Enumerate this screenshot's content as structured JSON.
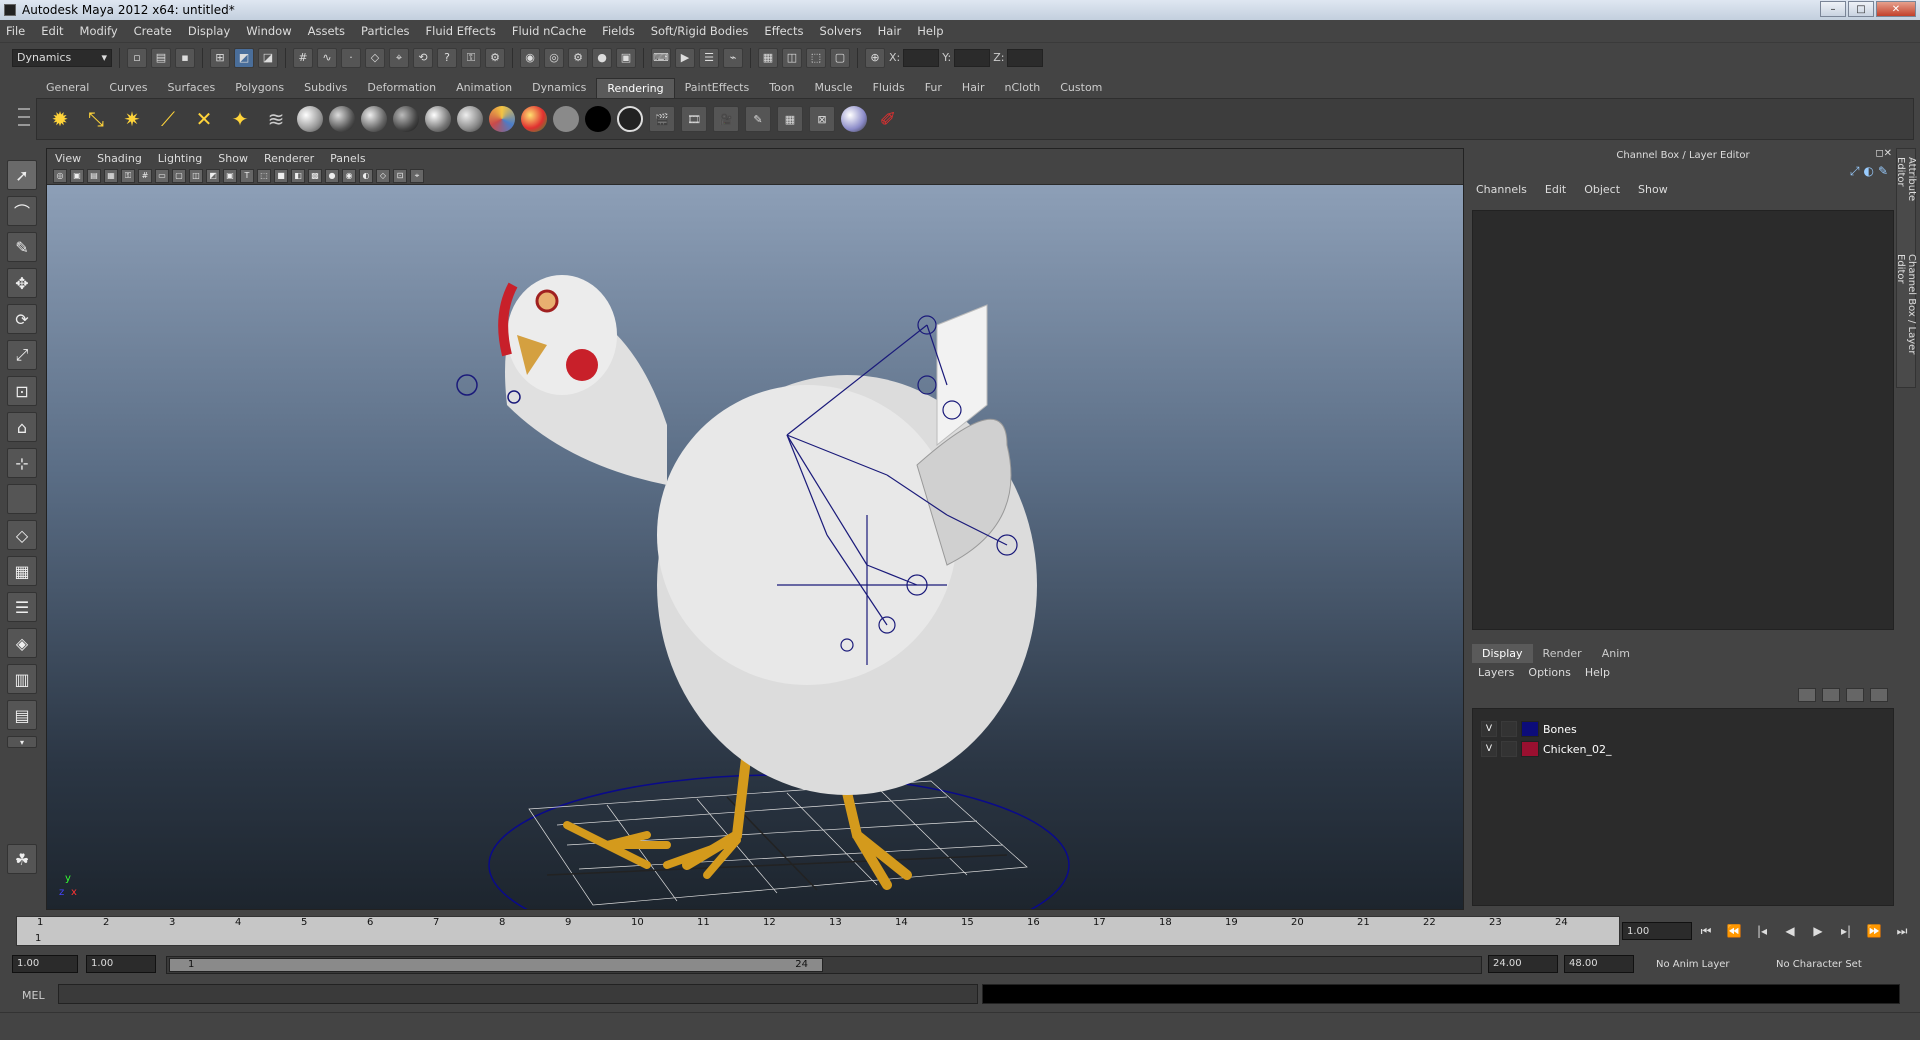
{
  "window": {
    "title": "Autodesk Maya 2012 x64: untitled*",
    "min": "–",
    "max": "□",
    "close": "✕"
  },
  "menubar": [
    "File",
    "Edit",
    "Modify",
    "Create",
    "Display",
    "Window",
    "Assets",
    "Particles",
    "Fluid Effects",
    "Fluid nCache",
    "Fields",
    "Soft/Rigid Bodies",
    "Effects",
    "Solvers",
    "Hair",
    "Help"
  ],
  "status_line": {
    "mode": "Dynamics",
    "x_label": "X:",
    "y_label": "Y:",
    "z_label": "Z:"
  },
  "shelf": {
    "tabs": [
      "General",
      "Curves",
      "Surfaces",
      "Polygons",
      "Subdivs",
      "Deformation",
      "Animation",
      "Dynamics",
      "Rendering",
      "PaintEffects",
      "Toon",
      "Muscle",
      "Fluids",
      "Fur",
      "Hair",
      "nCloth",
      "Custom"
    ],
    "active_tab": "Rendering",
    "light_icons": [
      "ambient-light-icon",
      "directional-light-icon",
      "point-light-icon",
      "spot-light-icon",
      "area-light-icon",
      "volume-light-icon",
      "image-plane-icon"
    ],
    "material_colors": [
      "#d8d8d8",
      "#777",
      "#999",
      "#666",
      "#888",
      "#aaa",
      "#c9a050",
      "#e03030",
      "#7a7a7a",
      "#000000",
      "#222222"
    ]
  },
  "viewport": {
    "menu": [
      "View",
      "Shading",
      "Lighting",
      "Show",
      "Renderer",
      "Panels"
    ],
    "axis_y": "y",
    "axis_x": "x",
    "axis_z": "z"
  },
  "channel_box": {
    "title": "Channel Box / Layer Editor",
    "menu": [
      "Channels",
      "Edit",
      "Object",
      "Show"
    ]
  },
  "layer_editor": {
    "tabs": [
      "Display",
      "Render",
      "Anim"
    ],
    "active_tab": "Display",
    "menu": [
      "Layers",
      "Options",
      "Help"
    ],
    "layers": [
      {
        "visible": "V",
        "name": "Bones",
        "color": "#0c0c7a"
      },
      {
        "visible": "V",
        "name": "Chicken_02_",
        "color": "#9a1030"
      }
    ]
  },
  "side_tabs": [
    "Attribute Editor",
    "Channel Box / Layer Editor"
  ],
  "time_slider": {
    "ticks": [
      "1",
      "2",
      "3",
      "4",
      "5",
      "6",
      "7",
      "8",
      "9",
      "10",
      "11",
      "12",
      "13",
      "14",
      "15",
      "16",
      "17",
      "18",
      "19",
      "20",
      "21",
      "22",
      "23",
      "24"
    ],
    "current_frame_marker": "1",
    "current_frame": "1.00"
  },
  "range_slider": {
    "start_time": "1.00",
    "playback_start": "1.00",
    "range_start_label": "1",
    "range_end_label": "24",
    "playback_end": "24.00",
    "end_time": "48.00",
    "anim_layer": "No Anim Layer",
    "character_set": "No Character Set"
  },
  "command_line": {
    "label": "MEL"
  }
}
